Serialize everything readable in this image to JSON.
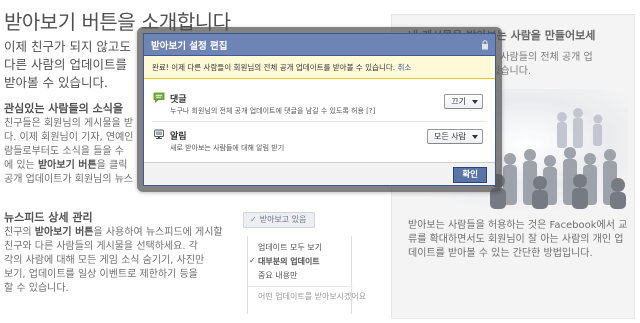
{
  "page": {
    "title": "받아보기 버튼을 소개합니다",
    "subtitle": "이제 친구가 되지 않고도 다른 사람의 업데이트를 받아볼 수 있습니다."
  },
  "section1": {
    "heading": "관심있는 사람들의 소식을",
    "body": [
      "친구들은 회원님의 게시물을 받",
      "다. 이제 회원님이 기자, 연예인",
      "람들로부터도 소식을 들을 수",
      "에 있는 받아보기 버튼을 클릭",
      "공개 업데이트가 회원님의 뉴스"
    ],
    "bold_term": "받아보기 버튼"
  },
  "section2": {
    "heading": "뉴스피드 상세 관리",
    "body": [
      "친구의 받아보기 버튼을 사용하여 뉴스피드에 게시할",
      "친구와 다른 사람들의 게시물을 선택하세요. 각",
      "각의 사람에 대해 모든 게임 소식 숨기기, 사진만",
      "보기, 업데이트를 일상 이벤트로 제한하기 등을",
      "할 수 있습니다."
    ],
    "bold_term": "받아보기 버튼"
  },
  "right_panel": {
    "title": "내 게시물을 받아보는 사람을 만들어보세",
    "subtitle_lines": [
      "친구 관계를 받아보는 사람들의 전체 공개 업",
      "데이트를 받아볼 수 있습니다."
    ],
    "description": "받아보는 사람들을 허용하는 것은 Facebook에서 교류를 확대하면서도 회원님이 잘 아는 사람의 개인 업데이트를 받아볼 수 있는 간단한 방법입니다."
  },
  "subscribed_button": {
    "label": "받아보고 있음",
    "check": "✓"
  },
  "bg_menu": {
    "items": [
      {
        "label": "업데이트 모두 보기",
        "selected": false
      },
      {
        "label": "대부분의 업데이트",
        "selected": true
      },
      {
        "label": "중요 내용만",
        "selected": false
      },
      {
        "label": "어떤 업데이트를 받아보시겠어요",
        "selected": false
      }
    ]
  },
  "dialog": {
    "title": "받아보기 설정 편집",
    "lock_icon": "lock-icon",
    "notice": "완료! 이제 다른 사람들이 회원님의 전체 공개 업데이트를 받아볼 수 있습니다.",
    "notice_cancel": "취소",
    "options": [
      {
        "icon": "comment-icon",
        "label": "댓글",
        "description": "누구나 회원님의 전체 공개 업데이트에 댓글을 남길 수 있도록 허용",
        "help": "[?]",
        "value": "끄기"
      },
      {
        "icon": "notification-icon",
        "label": "알림",
        "description": "새로 받아보는 사람들에 대해 알림 받기",
        "help": "",
        "value": "모든 사람"
      }
    ],
    "confirm_label": "확인"
  },
  "colors": {
    "fb_blue": "#3b5998",
    "header_blue": "#6d84b4",
    "notice_yellow": "#fff9d7",
    "confirm_button": "#5b74a8"
  }
}
